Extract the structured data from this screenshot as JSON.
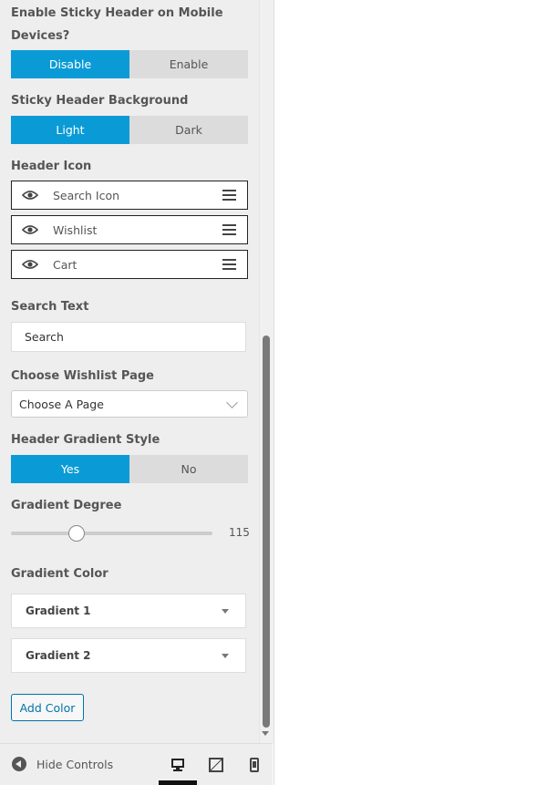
{
  "sticky_mobile": {
    "label_line1": "Enable Sticky Header on Mobile",
    "label_line2": "Devices?",
    "options": [
      "Disable",
      "Enable"
    ],
    "selected": "Disable"
  },
  "sticky_bg": {
    "label": "Sticky Header Background",
    "options": [
      "Light",
      "Dark"
    ],
    "selected": "Light"
  },
  "header_icon": {
    "label": "Header Icon",
    "items": [
      {
        "label": "Search Icon",
        "icon": "eye-icon"
      },
      {
        "label": "Wishlist",
        "icon": "eye-icon"
      },
      {
        "label": "Cart",
        "icon": "eye-icon"
      }
    ]
  },
  "search_text": {
    "label": "Search Text",
    "value": "Search"
  },
  "wishlist_page": {
    "label": "Choose Wishlist Page",
    "selected": "Choose A Page"
  },
  "gradient_style": {
    "label": "Header Gradient Style",
    "options": [
      "Yes",
      "No"
    ],
    "selected": "Yes"
  },
  "gradient_degree": {
    "label": "Gradient Degree",
    "value": "115",
    "min": 0,
    "max": 360
  },
  "gradient_color": {
    "label": "Gradient Color",
    "items": [
      "Gradient 1",
      "Gradient 2"
    ],
    "add_label": "Add Color"
  },
  "footer": {
    "hide_label": "Hide Controls",
    "devices": [
      "desktop-icon",
      "tablet-icon",
      "mobile-icon"
    ],
    "active_device": "desktop-icon"
  },
  "colors": {
    "accent": "#0a9bd6",
    "panel_bg": "#eeeeee",
    "link": "#0073aa"
  }
}
